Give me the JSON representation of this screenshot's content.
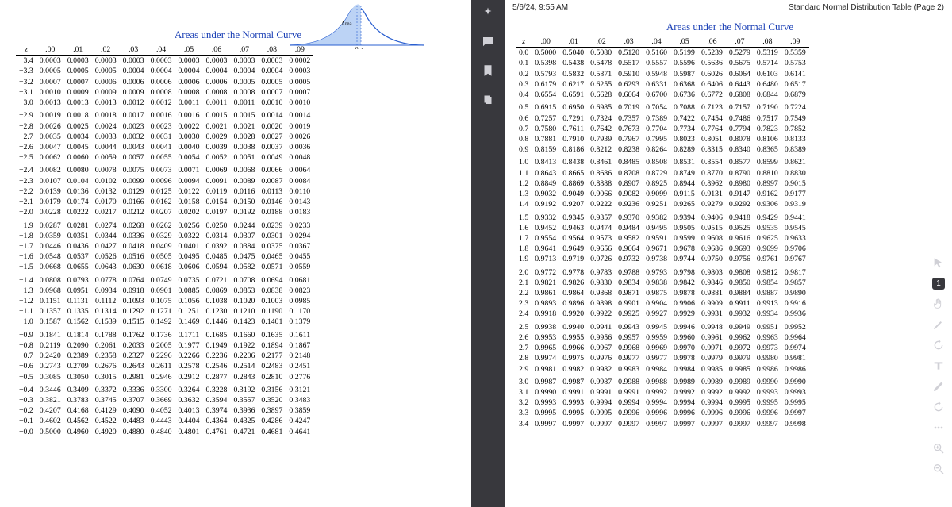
{
  "header": {
    "timestamp": "5/6/24, 9:55 AM",
    "doc_title": "Standard Normal Distribution Table (Page 2)"
  },
  "left": {
    "title": "Areas under the Normal Curve",
    "curve_label": "Area",
    "cols": [
      "z",
      ".00",
      ".01",
      ".02",
      ".03",
      ".04",
      ".05",
      ".06",
      ".07",
      ".08",
      ".09"
    ],
    "rows": [
      [
        "−3.4",
        "0.0003",
        "0.0003",
        "0.0003",
        "0.0003",
        "0.0003",
        "0.0003",
        "0.0003",
        "0.0003",
        "0.0003",
        "0.0002"
      ],
      [
        "−3.3",
        "0.0005",
        "0.0005",
        "0.0005",
        "0.0004",
        "0.0004",
        "0.0004",
        "0.0004",
        "0.0004",
        "0.0004",
        "0.0003"
      ],
      [
        "−3.2",
        "0.0007",
        "0.0007",
        "0.0006",
        "0.0006",
        "0.0006",
        "0.0006",
        "0.0006",
        "0.0005",
        "0.0005",
        "0.0005"
      ],
      [
        "−3.1",
        "0.0010",
        "0.0009",
        "0.0009",
        "0.0009",
        "0.0008",
        "0.0008",
        "0.0008",
        "0.0008",
        "0.0007",
        "0.0007"
      ],
      [
        "−3.0",
        "0.0013",
        "0.0013",
        "0.0013",
        "0.0012",
        "0.0012",
        "0.0011",
        "0.0011",
        "0.0011",
        "0.0010",
        "0.0010"
      ],
      [
        "−2.9",
        "0.0019",
        "0.0018",
        "0.0018",
        "0.0017",
        "0.0016",
        "0.0016",
        "0.0015",
        "0.0015",
        "0.0014",
        "0.0014"
      ],
      [
        "−2.8",
        "0.0026",
        "0.0025",
        "0.0024",
        "0.0023",
        "0.0023",
        "0.0022",
        "0.0021",
        "0.0021",
        "0.0020",
        "0.0019"
      ],
      [
        "−2.7",
        "0.0035",
        "0.0034",
        "0.0033",
        "0.0032",
        "0.0031",
        "0.0030",
        "0.0029",
        "0.0028",
        "0.0027",
        "0.0026"
      ],
      [
        "−2.6",
        "0.0047",
        "0.0045",
        "0.0044",
        "0.0043",
        "0.0041",
        "0.0040",
        "0.0039",
        "0.0038",
        "0.0037",
        "0.0036"
      ],
      [
        "−2.5",
        "0.0062",
        "0.0060",
        "0.0059",
        "0.0057",
        "0.0055",
        "0.0054",
        "0.0052",
        "0.0051",
        "0.0049",
        "0.0048"
      ],
      [
        "−2.4",
        "0.0082",
        "0.0080",
        "0.0078",
        "0.0075",
        "0.0073",
        "0.0071",
        "0.0069",
        "0.0068",
        "0.0066",
        "0.0064"
      ],
      [
        "−2.3",
        "0.0107",
        "0.0104",
        "0.0102",
        "0.0099",
        "0.0096",
        "0.0094",
        "0.0091",
        "0.0089",
        "0.0087",
        "0.0084"
      ],
      [
        "−2.2",
        "0.0139",
        "0.0136",
        "0.0132",
        "0.0129",
        "0.0125",
        "0.0122",
        "0.0119",
        "0.0116",
        "0.0113",
        "0.0110"
      ],
      [
        "−2.1",
        "0.0179",
        "0.0174",
        "0.0170",
        "0.0166",
        "0.0162",
        "0.0158",
        "0.0154",
        "0.0150",
        "0.0146",
        "0.0143"
      ],
      [
        "−2.0",
        "0.0228",
        "0.0222",
        "0.0217",
        "0.0212",
        "0.0207",
        "0.0202",
        "0.0197",
        "0.0192",
        "0.0188",
        "0.0183"
      ],
      [
        "−1.9",
        "0.0287",
        "0.0281",
        "0.0274",
        "0.0268",
        "0.0262",
        "0.0256",
        "0.0250",
        "0.0244",
        "0.0239",
        "0.0233"
      ],
      [
        "−1.8",
        "0.0359",
        "0.0351",
        "0.0344",
        "0.0336",
        "0.0329",
        "0.0322",
        "0.0314",
        "0.0307",
        "0.0301",
        "0.0294"
      ],
      [
        "−1.7",
        "0.0446",
        "0.0436",
        "0.0427",
        "0.0418",
        "0.0409",
        "0.0401",
        "0.0392",
        "0.0384",
        "0.0375",
        "0.0367"
      ],
      [
        "−1.6",
        "0.0548",
        "0.0537",
        "0.0526",
        "0.0516",
        "0.0505",
        "0.0495",
        "0.0485",
        "0.0475",
        "0.0465",
        "0.0455"
      ],
      [
        "−1.5",
        "0.0668",
        "0.0655",
        "0.0643",
        "0.0630",
        "0.0618",
        "0.0606",
        "0.0594",
        "0.0582",
        "0.0571",
        "0.0559"
      ],
      [
        "−1.4",
        "0.0808",
        "0.0793",
        "0.0778",
        "0.0764",
        "0.0749",
        "0.0735",
        "0.0721",
        "0.0708",
        "0.0694",
        "0.0681"
      ],
      [
        "−1.3",
        "0.0968",
        "0.0951",
        "0.0934",
        "0.0918",
        "0.0901",
        "0.0885",
        "0.0869",
        "0.0853",
        "0.0838",
        "0.0823"
      ],
      [
        "−1.2",
        "0.1151",
        "0.1131",
        "0.1112",
        "0.1093",
        "0.1075",
        "0.1056",
        "0.1038",
        "0.1020",
        "0.1003",
        "0.0985"
      ],
      [
        "−1.1",
        "0.1357",
        "0.1335",
        "0.1314",
        "0.1292",
        "0.1271",
        "0.1251",
        "0.1230",
        "0.1210",
        "0.1190",
        "0.1170"
      ],
      [
        "−1.0",
        "0.1587",
        "0.1562",
        "0.1539",
        "0.1515",
        "0.1492",
        "0.1469",
        "0.1446",
        "0.1423",
        "0.1401",
        "0.1379"
      ],
      [
        "−0.9",
        "0.1841",
        "0.1814",
        "0.1788",
        "0.1762",
        "0.1736",
        "0.1711",
        "0.1685",
        "0.1660",
        "0.1635",
        "0.1611"
      ],
      [
        "−0.8",
        "0.2119",
        "0.2090",
        "0.2061",
        "0.2033",
        "0.2005",
        "0.1977",
        "0.1949",
        "0.1922",
        "0.1894",
        "0.1867"
      ],
      [
        "−0.7",
        "0.2420",
        "0.2389",
        "0.2358",
        "0.2327",
        "0.2296",
        "0.2266",
        "0.2236",
        "0.2206",
        "0.2177",
        "0.2148"
      ],
      [
        "−0.6",
        "0.2743",
        "0.2709",
        "0.2676",
        "0.2643",
        "0.2611",
        "0.2578",
        "0.2546",
        "0.2514",
        "0.2483",
        "0.2451"
      ],
      [
        "−0.5",
        "0.3085",
        "0.3050",
        "0.3015",
        "0.2981",
        "0.2946",
        "0.2912",
        "0.2877",
        "0.2843",
        "0.2810",
        "0.2776"
      ],
      [
        "−0.4",
        "0.3446",
        "0.3409",
        "0.3372",
        "0.3336",
        "0.3300",
        "0.3264",
        "0.3228",
        "0.3192",
        "0.3156",
        "0.3121"
      ],
      [
        "−0.3",
        "0.3821",
        "0.3783",
        "0.3745",
        "0.3707",
        "0.3669",
        "0.3632",
        "0.3594",
        "0.3557",
        "0.3520",
        "0.3483"
      ],
      [
        "−0.2",
        "0.4207",
        "0.4168",
        "0.4129",
        "0.4090",
        "0.4052",
        "0.4013",
        "0.3974",
        "0.3936",
        "0.3897",
        "0.3859"
      ],
      [
        "−0.1",
        "0.4602",
        "0.4562",
        "0.4522",
        "0.4483",
        "0.4443",
        "0.4404",
        "0.4364",
        "0.4325",
        "0.4286",
        "0.4247"
      ],
      [
        "−0.0",
        "0.5000",
        "0.4960",
        "0.4920",
        "0.4880",
        "0.4840",
        "0.4801",
        "0.4761",
        "0.4721",
        "0.4681",
        "0.4641"
      ]
    ],
    "group_breaks": [
      5,
      10,
      15,
      20,
      25,
      30
    ]
  },
  "right": {
    "title": "Areas under the Normal Curve",
    "cols": [
      "z",
      ".00",
      ".01",
      ".02",
      ".03",
      ".04",
      ".05",
      ".06",
      ".07",
      ".08",
      ".09"
    ],
    "rows": [
      [
        "0.0",
        "0.5000",
        "0.5040",
        "0.5080",
        "0.5120",
        "0.5160",
        "0.5199",
        "0.5239",
        "0.5279",
        "0.5319",
        "0.5359"
      ],
      [
        "0.1",
        "0.5398",
        "0.5438",
        "0.5478",
        "0.5517",
        "0.5557",
        "0.5596",
        "0.5636",
        "0.5675",
        "0.5714",
        "0.5753"
      ],
      [
        "0.2",
        "0.5793",
        "0.5832",
        "0.5871",
        "0.5910",
        "0.5948",
        "0.5987",
        "0.6026",
        "0.6064",
        "0.6103",
        "0.6141"
      ],
      [
        "0.3",
        "0.6179",
        "0.6217",
        "0.6255",
        "0.6293",
        "0.6331",
        "0.6368",
        "0.6406",
        "0.6443",
        "0.6480",
        "0.6517"
      ],
      [
        "0.4",
        "0.6554",
        "0.6591",
        "0.6628",
        "0.6664",
        "0.6700",
        "0.6736",
        "0.6772",
        "0.6808",
        "0.6844",
        "0.6879"
      ],
      [
        "0.5",
        "0.6915",
        "0.6950",
        "0.6985",
        "0.7019",
        "0.7054",
        "0.7088",
        "0.7123",
        "0.7157",
        "0.7190",
        "0.7224"
      ],
      [
        "0.6",
        "0.7257",
        "0.7291",
        "0.7324",
        "0.7357",
        "0.7389",
        "0.7422",
        "0.7454",
        "0.7486",
        "0.7517",
        "0.7549"
      ],
      [
        "0.7",
        "0.7580",
        "0.7611",
        "0.7642",
        "0.7673",
        "0.7704",
        "0.7734",
        "0.7764",
        "0.7794",
        "0.7823",
        "0.7852"
      ],
      [
        "0.8",
        "0.7881",
        "0.7910",
        "0.7939",
        "0.7967",
        "0.7995",
        "0.8023",
        "0.8051",
        "0.8078",
        "0.8106",
        "0.8133"
      ],
      [
        "0.9",
        "0.8159",
        "0.8186",
        "0.8212",
        "0.8238",
        "0.8264",
        "0.8289",
        "0.8315",
        "0.8340",
        "0.8365",
        "0.8389"
      ],
      [
        "1.0",
        "0.8413",
        "0.8438",
        "0.8461",
        "0.8485",
        "0.8508",
        "0.8531",
        "0.8554",
        "0.8577",
        "0.8599",
        "0.8621"
      ],
      [
        "1.1",
        "0.8643",
        "0.8665",
        "0.8686",
        "0.8708",
        "0.8729",
        "0.8749",
        "0.8770",
        "0.8790",
        "0.8810",
        "0.8830"
      ],
      [
        "1.2",
        "0.8849",
        "0.8869",
        "0.8888",
        "0.8907",
        "0.8925",
        "0.8944",
        "0.8962",
        "0.8980",
        "0.8997",
        "0.9015"
      ],
      [
        "1.3",
        "0.9032",
        "0.9049",
        "0.9066",
        "0.9082",
        "0.9099",
        "0.9115",
        "0.9131",
        "0.9147",
        "0.9162",
        "0.9177"
      ],
      [
        "1.4",
        "0.9192",
        "0.9207",
        "0.9222",
        "0.9236",
        "0.9251",
        "0.9265",
        "0.9279",
        "0.9292",
        "0.9306",
        "0.9319"
      ],
      [
        "1.5",
        "0.9332",
        "0.9345",
        "0.9357",
        "0.9370",
        "0.9382",
        "0.9394",
        "0.9406",
        "0.9418",
        "0.9429",
        "0.9441"
      ],
      [
        "1.6",
        "0.9452",
        "0.9463",
        "0.9474",
        "0.9484",
        "0.9495",
        "0.9505",
        "0.9515",
        "0.9525",
        "0.9535",
        "0.9545"
      ],
      [
        "1.7",
        "0.9554",
        "0.9564",
        "0.9573",
        "0.9582",
        "0.9591",
        "0.9599",
        "0.9608",
        "0.9616",
        "0.9625",
        "0.9633"
      ],
      [
        "1.8",
        "0.9641",
        "0.9649",
        "0.9656",
        "0.9664",
        "0.9671",
        "0.9678",
        "0.9686",
        "0.9693",
        "0.9699",
        "0.9706"
      ],
      [
        "1.9",
        "0.9713",
        "0.9719",
        "0.9726",
        "0.9732",
        "0.9738",
        "0.9744",
        "0.9750",
        "0.9756",
        "0.9761",
        "0.9767"
      ],
      [
        "2.0",
        "0.9772",
        "0.9778",
        "0.9783",
        "0.9788",
        "0.9793",
        "0.9798",
        "0.9803",
        "0.9808",
        "0.9812",
        "0.9817"
      ],
      [
        "2.1",
        "0.9821",
        "0.9826",
        "0.9830",
        "0.9834",
        "0.9838",
        "0.9842",
        "0.9846",
        "0.9850",
        "0.9854",
        "0.9857"
      ],
      [
        "2.2",
        "0.9861",
        "0.9864",
        "0.9868",
        "0.9871",
        "0.9875",
        "0.9878",
        "0.9881",
        "0.9884",
        "0.9887",
        "0.9890"
      ],
      [
        "2.3",
        "0.9893",
        "0.9896",
        "0.9898",
        "0.9901",
        "0.9904",
        "0.9906",
        "0.9909",
        "0.9911",
        "0.9913",
        "0.9916"
      ],
      [
        "2.4",
        "0.9918",
        "0.9920",
        "0.9922",
        "0.9925",
        "0.9927",
        "0.9929",
        "0.9931",
        "0.9932",
        "0.9934",
        "0.9936"
      ],
      [
        "2.5",
        "0.9938",
        "0.9940",
        "0.9941",
        "0.9943",
        "0.9945",
        "0.9946",
        "0.9948",
        "0.9949",
        "0.9951",
        "0.9952"
      ],
      [
        "2.6",
        "0.9953",
        "0.9955",
        "0.9956",
        "0.9957",
        "0.9959",
        "0.9960",
        "0.9961",
        "0.9962",
        "0.9963",
        "0.9964"
      ],
      [
        "2.7",
        "0.9965",
        "0.9966",
        "0.9967",
        "0.9968",
        "0.9969",
        "0.9970",
        "0.9971",
        "0.9972",
        "0.9973",
        "0.9974"
      ],
      [
        "2.8",
        "0.9974",
        "0.9975",
        "0.9976",
        "0.9977",
        "0.9977",
        "0.9978",
        "0.9979",
        "0.9979",
        "0.9980",
        "0.9981"
      ],
      [
        "2.9",
        "0.9981",
        "0.9982",
        "0.9982",
        "0.9983",
        "0.9984",
        "0.9984",
        "0.9985",
        "0.9985",
        "0.9986",
        "0.9986"
      ],
      [
        "3.0",
        "0.9987",
        "0.9987",
        "0.9987",
        "0.9988",
        "0.9988",
        "0.9989",
        "0.9989",
        "0.9989",
        "0.9990",
        "0.9990"
      ],
      [
        "3.1",
        "0.9990",
        "0.9991",
        "0.9991",
        "0.9991",
        "0.9992",
        "0.9992",
        "0.9992",
        "0.9992",
        "0.9993",
        "0.9993"
      ],
      [
        "3.2",
        "0.9993",
        "0.9993",
        "0.9994",
        "0.9994",
        "0.9994",
        "0.9994",
        "0.9994",
        "0.9995",
        "0.9995",
        "0.9995"
      ],
      [
        "3.3",
        "0.9995",
        "0.9995",
        "0.9995",
        "0.9996",
        "0.9996",
        "0.9996",
        "0.9996",
        "0.9996",
        "0.9996",
        "0.9997"
      ],
      [
        "3.4",
        "0.9997",
        "0.9997",
        "0.9997",
        "0.9997",
        "0.9997",
        "0.9997",
        "0.9997",
        "0.9997",
        "0.9997",
        "0.9998"
      ]
    ],
    "group_breaks": [
      5,
      10,
      15,
      20,
      25,
      30
    ]
  },
  "toolbar": {
    "page_current": "1",
    "page_input": "1"
  }
}
